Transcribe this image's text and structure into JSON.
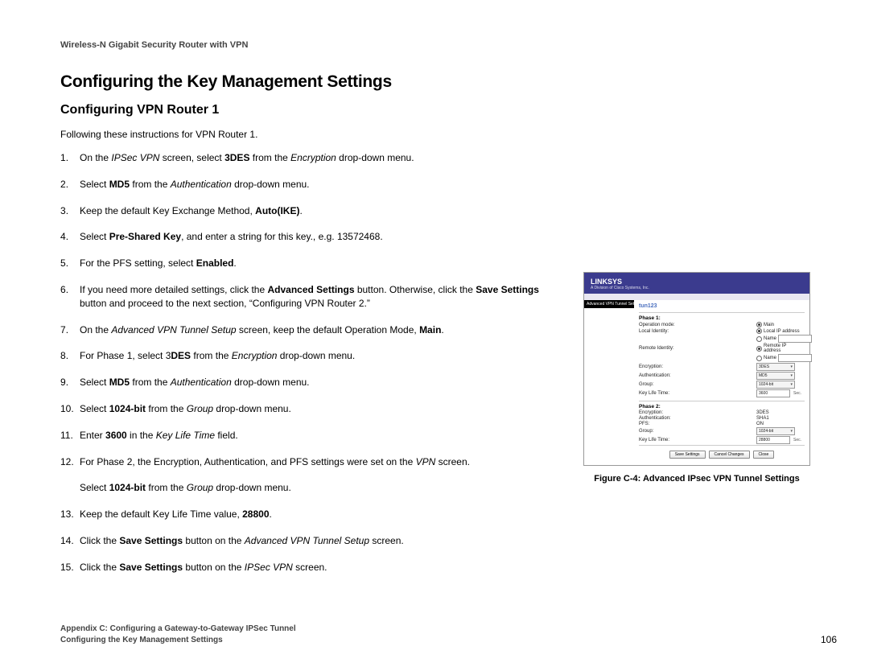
{
  "doc_header": "Wireless-N Gigabit Security Router with VPN",
  "h1": "Configuring the Key Management Settings",
  "h2": "Configuring VPN Router 1",
  "intro": "Following these instructions for VPN Router 1.",
  "steps": {
    "s1_a": "On the ",
    "s1_i1": "IPSec VPN",
    "s1_b": " screen, select ",
    "s1_bold1": "3DES",
    "s1_c": " from the ",
    "s1_i2": "Encryption",
    "s1_d": " drop-down menu.",
    "s2_a": "Select ",
    "s2_bold1": "MD5",
    "s2_b": " from the ",
    "s2_i1": "Authentication",
    "s2_c": " drop-down menu.",
    "s3_a": "Keep the default Key Exchange Method, ",
    "s3_bold1": "Auto(IKE)",
    "s3_b": ".",
    "s4_a": "Select ",
    "s4_bold1": "Pre-Shared Key",
    "s4_b": ", and enter a string for this key., e.g. 13572468.",
    "s5_a": "For the PFS setting, select ",
    "s5_bold1": "Enabled",
    "s5_b": ".",
    "s6_a": "If you need more detailed settings, click the ",
    "s6_bold1": "Advanced Settings",
    "s6_b": " button. Otherwise, click the ",
    "s6_bold2": "Save Settings",
    "s6_c": " button and proceed to the next section, “Configuring VPN Router 2.”",
    "s7_a": "On the ",
    "s7_i1": "Advanced VPN Tunnel Setup",
    "s7_b": " screen, keep the default Operation Mode, ",
    "s7_bold1": "Main",
    "s7_c": ".",
    "s8_a": "For Phase 1, select 3",
    "s8_bold1": "DES",
    "s8_b": " from the ",
    "s8_i1": "Encryption",
    "s8_c": " drop-down menu.",
    "s9_a": "Select ",
    "s9_bold1": "MD5",
    "s9_b": " from the ",
    "s9_i1": "Authentication",
    "s9_c": " drop-down menu.",
    "s10_a": "Select ",
    "s10_bold1": "1024-bit",
    "s10_b": " from the ",
    "s10_i1": "Group",
    "s10_c": " drop-down menu.",
    "s11_a": "Enter ",
    "s11_bold1": "3600",
    "s11_b": " in the ",
    "s11_i1": "Key Life Time",
    "s11_c": " field.",
    "s12_a": "For Phase 2, the Encryption, Authentication, and PFS settings were set on the ",
    "s12_i1": "VPN",
    "s12_b": " screen.",
    "s12_cont_a": "Select ",
    "s12_cont_bold1": "1024-bit",
    "s12_cont_b": " from the ",
    "s12_cont_i1": "Group",
    "s12_cont_c": " drop-down menu.",
    "s13_a": "Keep the default Key Life Time value, ",
    "s13_bold1": "28800",
    "s13_b": ".",
    "s14_a": "Click the ",
    "s14_bold1": "Save Settings",
    "s14_b": " button on the ",
    "s14_i1": "Advanced VPN Tunnel Setup",
    "s14_c": " screen.",
    "s15_a": "Click the ",
    "s15_bold1": "Save Settings",
    "s15_b": " button on the ",
    "s15_i1": "IPSec VPN",
    "s15_c": " screen."
  },
  "figure": {
    "brand": "LINKSYS",
    "brand_sub": "A Division of Cisco Systems, Inc.",
    "left_tab": "Advanced VPN Tunnel Setup",
    "tunnel_id": "tun123",
    "phase1": "Phase 1:",
    "row_op_mode": "Operation mode:",
    "op_main": "Main",
    "row_local_id": "Local Identity:",
    "local_id_opt": "Local IP address",
    "local_id_name": "Name",
    "row_remote_id": "Remote Identity:",
    "remote_id_opt": "Remote IP address",
    "remote_id_name": "Name",
    "row_enc": "Encryption:",
    "enc_val": "3DES",
    "row_auth": "Authentication:",
    "auth_val": "MD5",
    "row_group": "Group:",
    "group_val": "1024-bit",
    "row_klt": "Key Life Time:",
    "klt1_val": "3600",
    "unit": "Sec.",
    "phase2": "Phase 2:",
    "p2_enc_val": "3DES",
    "p2_auth_val": "SHA1",
    "row_pfs": "PFS:",
    "pfs_val": "ON",
    "p2_group_val": "1024-bit",
    "klt2_val": "28800",
    "btn_save": "Save Settings",
    "btn_cancel": "Cancel Changes",
    "btn_close": "Close",
    "caption": "Figure C-4: Advanced IPsec VPN Tunnel Settings"
  },
  "footer": {
    "line1": "Appendix C: Configuring a Gateway-to-Gateway IPSec Tunnel",
    "line2": "Configuring the Key Management Settings",
    "page": "106"
  }
}
